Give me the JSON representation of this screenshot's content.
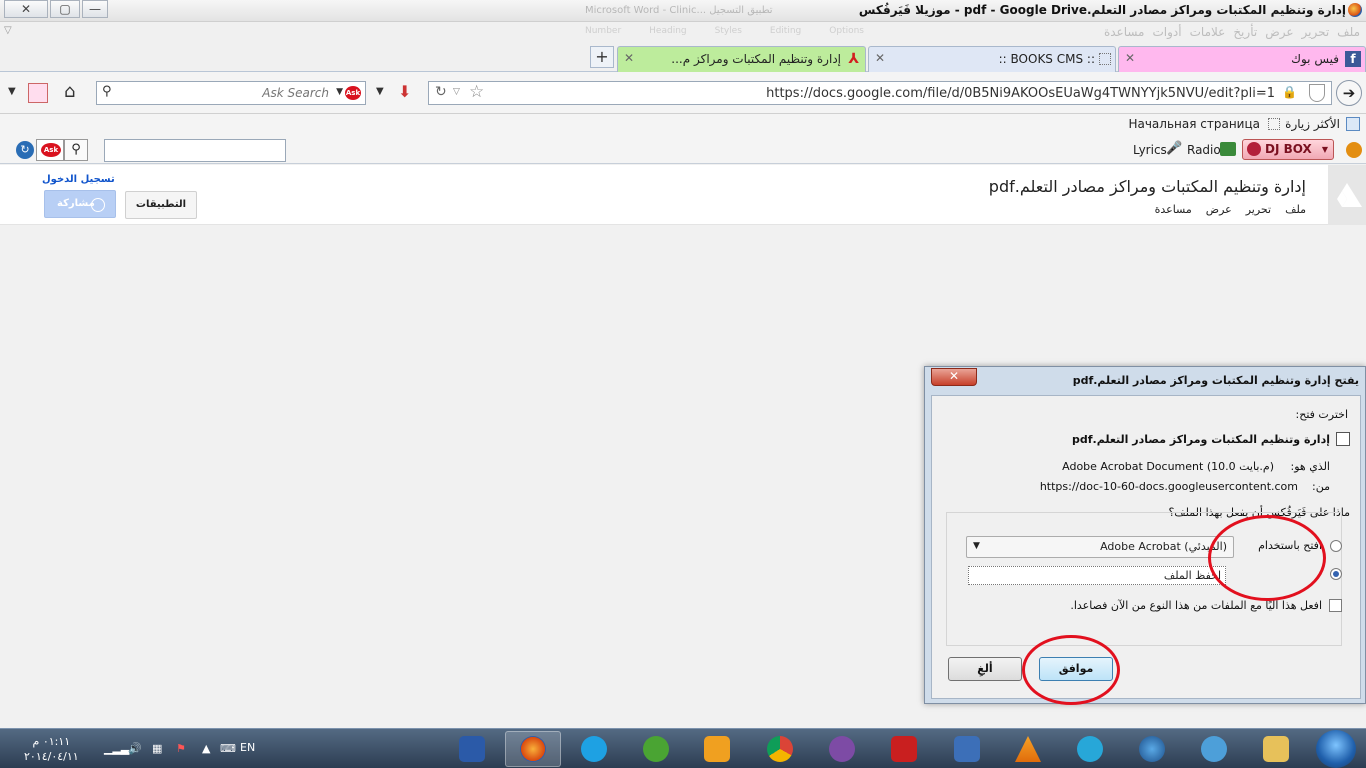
{
  "window": {
    "title": "إدارة وتنظيم المكتبات ومراكز مصادر التعلم.pdf - Google Drive - موزيلا فَيَرفُكس",
    "ghost_title": "Microsoft Word - Clinic... تطبيق التسجيل",
    "buttons": {
      "close": "✕",
      "restore": "▢",
      "minimize": "—"
    }
  },
  "menubar": {
    "items": [
      "ملف",
      "تحرير",
      "عرض",
      "تأريخ",
      "علامات",
      "أدوات",
      "مساعدة"
    ],
    "ghost_items": [
      "Number",
      "Heading",
      "Styles",
      "Editing",
      "Options"
    ]
  },
  "tabs": [
    {
      "label": "فيس بوك",
      "close": "✕"
    },
    {
      "label": ":: BOOKS CMS ::",
      "close": "✕"
    },
    {
      "label": "إدارة وتنظيم المكتبات ومراكز م...",
      "close": "✕"
    }
  ],
  "newtab_label": "+",
  "navbar": {
    "search_placeholder": "Ask Search",
    "url": "https://docs.google.com/file/d/0B5Ni9AKOOsEUaWg4TWNYYjk5NVU/edit?pli=1"
  },
  "bookmarks": {
    "most_visited": "الأكثر زيارة",
    "home": "Начальная страница"
  },
  "toolbar2": {
    "dj_box": "DJ BOX",
    "radio": "Radio",
    "lyrics": "Lyrics",
    "ask_logo": "Ask"
  },
  "drive": {
    "doc_title": "إدارة وتنظيم المكتبات ومراكز مصادر التعلم.pdf",
    "menus": [
      "ملف",
      "تحرير",
      "عرض",
      "مساعدة"
    ],
    "signin": "تسجيل الدخول",
    "share": "مشاركة",
    "apps": "التطبيقات"
  },
  "dialog": {
    "title": "يفتح إدارة وتنظيم المكتبات ومراكز مصادر التعلم.pdf",
    "close": "✕",
    "chosen_label": "اخترت فتح:",
    "filename": "إدارة وتنظيم المكتبات ومراكز مصادر التعلم.pdf",
    "type_label": "الذي هو:",
    "type_value": "Adobe Acrobat Document (10.0 م.بايت)",
    "from_label": "من:",
    "from_value": "https://doc-10-60-docs.googleusercontent.com",
    "question": "ماذا على فَيَرفُكس أن يفعل بهذا الملف؟",
    "open_with_label": "افتح باستخدام",
    "open_with_app": "Adobe Acrobat  (المبدئي)",
    "save_label": "احفظ الملف",
    "remember_label": "افعل هذا آليًا مع الملفات من هذا النوع من الآن فصاعدا.",
    "ok": "موافق",
    "cancel": "ألغِ"
  },
  "taskbar": {
    "time": "٠١:١١ م",
    "date": "٢٠١٤/٠٤/١١",
    "language": "EN",
    "apps": [
      "word",
      "firefox",
      "skype",
      "utorrent",
      "media-player",
      "chrome",
      "viber",
      "acrobat",
      "media-player-classic",
      "vlc",
      "daemon-tools",
      "google-earth",
      "network",
      "file-explorer"
    ]
  }
}
